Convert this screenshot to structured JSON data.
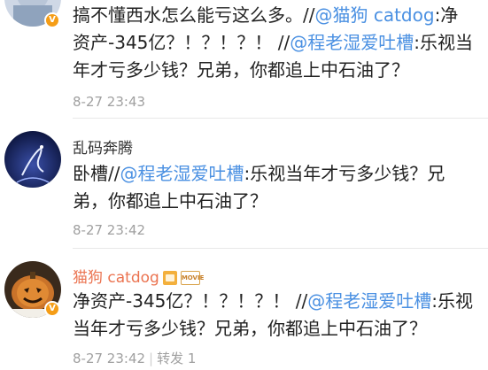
{
  "comments": [
    {
      "username": "",
      "text_parts": [
        "搞不懂西水怎么能亏这么多。//",
        "@猫狗 catdog",
        ":净资产-345亿？！？！？！ //",
        "@程老湿爱吐槽",
        ":乐视当年才亏多少钱？兄弟，你都追上中石油了？"
      ],
      "time": "8-27 23:43",
      "verified": true
    },
    {
      "username": "乱码奔腾",
      "text_parts": [
        "卧槽//",
        "@程老湿爱吐槽",
        ":乐视当年才亏多少钱？兄弟，你都追上中石油了？"
      ],
      "time": "8-27 23:42",
      "verified": false
    },
    {
      "username": "猫狗 catdog",
      "text_parts": [
        "净资产-345亿？！？！？！ //",
        "@程老湿爱吐槽",
        ":乐视当年才亏多少钱？兄弟，你都追上中石油了？"
      ],
      "time": "8-27 23:42",
      "repost_label": "转发 1",
      "badge_movie_text": "MOVIE",
      "verified": true
    }
  ],
  "colors": {
    "mention": "#4a90e2",
    "username_member": "#eb7350",
    "verified_badge": "#f59d16"
  }
}
